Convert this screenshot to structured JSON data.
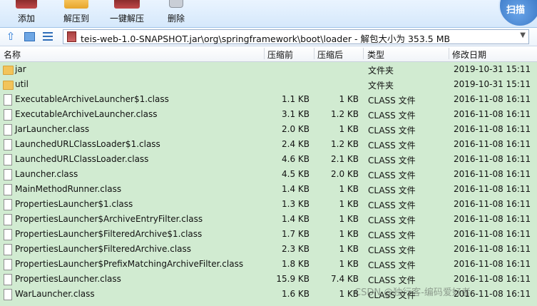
{
  "toolbar": {
    "add_label": "添加",
    "extract_label": "解压到",
    "onekey_label": "一键解压",
    "delete_label": "删除",
    "scan_label": "扫描"
  },
  "address": {
    "path": "teis-web-1.0-SNAPSHOT.jar\\org\\springframework\\boot\\loader - 解包大小为 353.5 MB"
  },
  "columns": {
    "name": "名称",
    "compressed": "压缩前",
    "size": "压缩后",
    "type": "类型",
    "modified": "修改日期"
  },
  "rows": [
    {
      "name": "jar",
      "compressed": "",
      "size": "",
      "type": "文件夹",
      "modified": "2019-10-31 15:11",
      "icon": "folder-icon"
    },
    {
      "name": "util",
      "compressed": "",
      "size": "",
      "type": "文件夹",
      "modified": "2019-10-31 15:11",
      "icon": "folder-icon"
    },
    {
      "name": "ExecutableArchiveLauncher$1.class",
      "compressed": "1.1 KB",
      "size": "1 KB",
      "type": "CLASS 文件",
      "modified": "2016-11-08 16:11",
      "icon": "file-icon"
    },
    {
      "name": "ExecutableArchiveLauncher.class",
      "compressed": "3.1 KB",
      "size": "1.2 KB",
      "type": "CLASS 文件",
      "modified": "2016-11-08 16:11",
      "icon": "file-icon"
    },
    {
      "name": "JarLauncher.class",
      "compressed": "2.0 KB",
      "size": "1 KB",
      "type": "CLASS 文件",
      "modified": "2016-11-08 16:11",
      "icon": "file-icon"
    },
    {
      "name": "LaunchedURLClassLoader$1.class",
      "compressed": "2.4 KB",
      "size": "1.2 KB",
      "type": "CLASS 文件",
      "modified": "2016-11-08 16:11",
      "icon": "file-icon"
    },
    {
      "name": "LaunchedURLClassLoader.class",
      "compressed": "4.6 KB",
      "size": "2.1 KB",
      "type": "CLASS 文件",
      "modified": "2016-11-08 16:11",
      "icon": "file-icon"
    },
    {
      "name": "Launcher.class",
      "compressed": "4.5 KB",
      "size": "2.0 KB",
      "type": "CLASS 文件",
      "modified": "2016-11-08 16:11",
      "icon": "file-icon"
    },
    {
      "name": "MainMethodRunner.class",
      "compressed": "1.4 KB",
      "size": "1 KB",
      "type": "CLASS 文件",
      "modified": "2016-11-08 16:11",
      "icon": "file-icon"
    },
    {
      "name": "PropertiesLauncher$1.class",
      "compressed": "1.3 KB",
      "size": "1 KB",
      "type": "CLASS 文件",
      "modified": "2016-11-08 16:11",
      "icon": "file-icon"
    },
    {
      "name": "PropertiesLauncher$ArchiveEntryFilter.class",
      "compressed": "1.4 KB",
      "size": "1 KB",
      "type": "CLASS 文件",
      "modified": "2016-11-08 16:11",
      "icon": "file-icon"
    },
    {
      "name": "PropertiesLauncher$FilteredArchive$1.class",
      "compressed": "1.7 KB",
      "size": "1 KB",
      "type": "CLASS 文件",
      "modified": "2016-11-08 16:11",
      "icon": "file-icon"
    },
    {
      "name": "PropertiesLauncher$FilteredArchive.class",
      "compressed": "2.3 KB",
      "size": "1 KB",
      "type": "CLASS 文件",
      "modified": "2016-11-08 16:11",
      "icon": "file-icon"
    },
    {
      "name": "PropertiesLauncher$PrefixMatchingArchiveFilter.class",
      "compressed": "1.8 KB",
      "size": "1 KB",
      "type": "CLASS 文件",
      "modified": "2016-11-08 16:11",
      "icon": "file-icon"
    },
    {
      "name": "PropertiesLauncher.class",
      "compressed": "15.9 KB",
      "size": "7.4 KB",
      "type": "CLASS 文件",
      "modified": "2016-11-08 16:11",
      "icon": "file-icon"
    },
    {
      "name": "WarLauncher.class",
      "compressed": "1.6 KB",
      "size": "1 KB",
      "type": "CLASS 文件",
      "modified": "2016-11-08 16:11",
      "icon": "file-icon"
    }
  ],
  "watermark": "CSDN @独行客-编码爱好者"
}
